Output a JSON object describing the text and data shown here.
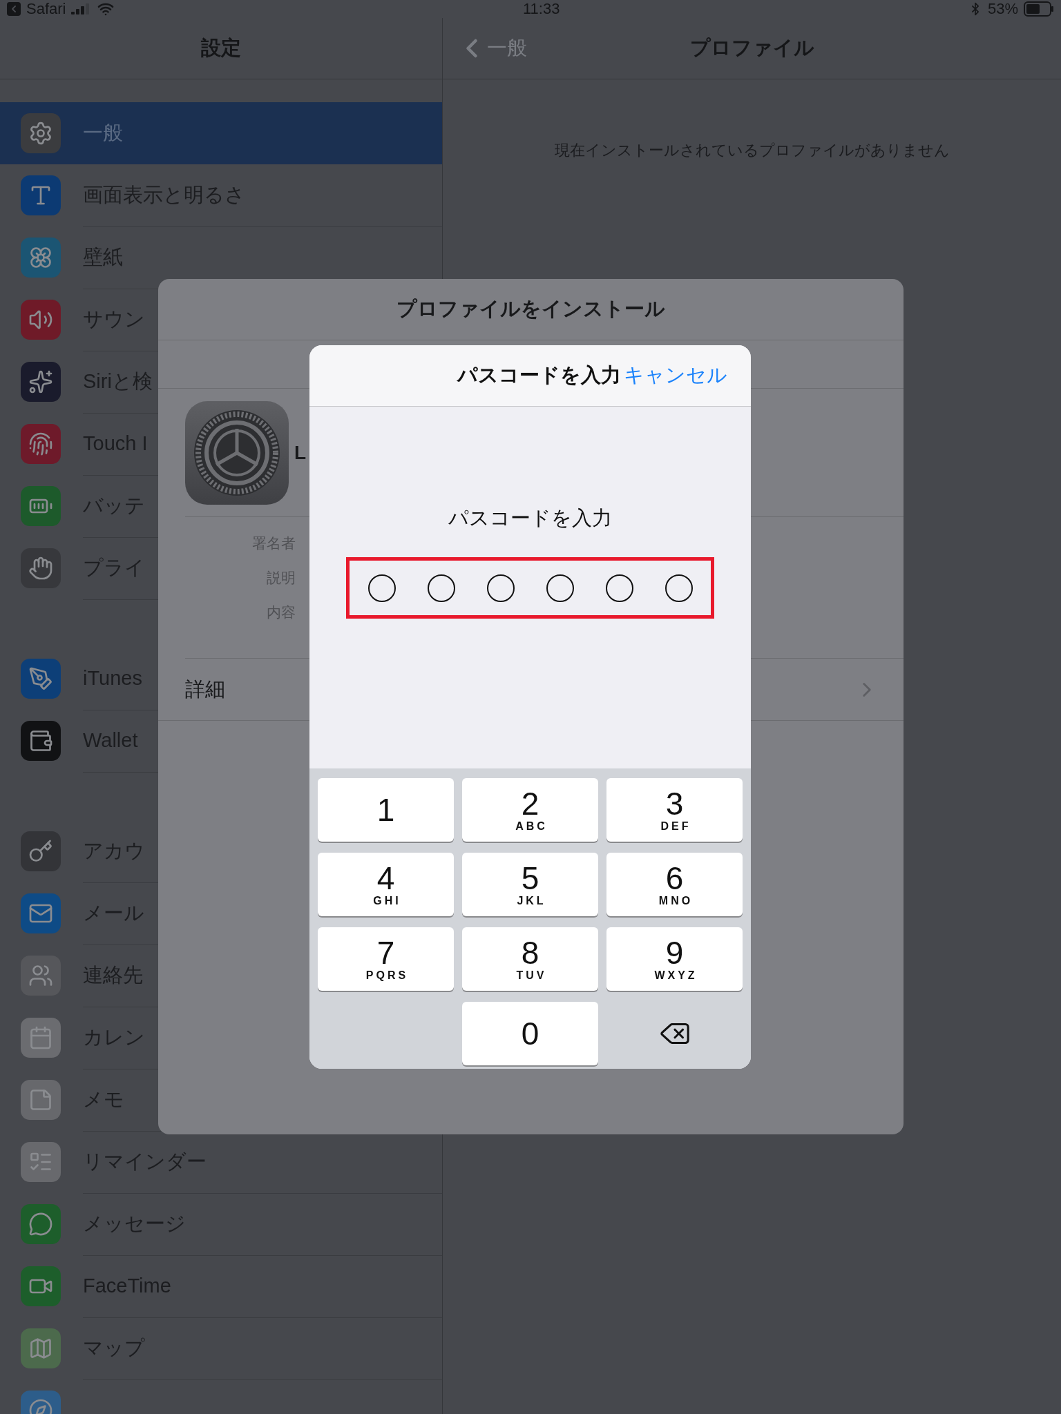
{
  "status_bar": {
    "back_app": "Safari",
    "time": "11:33",
    "battery": "53%"
  },
  "sidebar": {
    "title": "設定",
    "groups": [
      {
        "items": [
          {
            "label": "一般",
            "selected": true
          },
          {
            "label": "画面表示と明るさ",
            "selected": false
          },
          {
            "label": "壁紙",
            "selected": false
          },
          {
            "label": "サウン",
            "selected": false
          },
          {
            "label": "Siriと検",
            "selected": false
          },
          {
            "label": "Touch I",
            "selected": false
          },
          {
            "label": "バッテ",
            "selected": false
          },
          {
            "label": "プライ",
            "selected": false
          }
        ]
      },
      {
        "items": [
          {
            "label": "iTunes",
            "selected": false
          },
          {
            "label": "Wallet",
            "selected": false
          }
        ]
      },
      {
        "items": [
          {
            "label": "アカウ",
            "selected": false
          },
          {
            "label": "メール",
            "selected": false
          },
          {
            "label": "連絡先",
            "selected": false
          },
          {
            "label": "カレン",
            "selected": false
          },
          {
            "label": "メモ",
            "selected": false
          },
          {
            "label": "リマインダー",
            "selected": false
          },
          {
            "label": "メッセージ",
            "selected": false
          },
          {
            "label": "FaceTime",
            "selected": false
          },
          {
            "label": "マップ",
            "selected": false
          },
          {
            "selected": false
          }
        ]
      }
    ]
  },
  "detail": {
    "back": "一般",
    "title": "プロファイル",
    "empty_message": "現在インストールされているプロファイルがありません"
  },
  "install_sheet": {
    "title": "プロファイルをインストール",
    "profile_name": "L",
    "fields": [
      "署名者",
      "説明",
      "内容"
    ],
    "more": "詳細"
  },
  "passcode_dialog": {
    "title": "パスコードを入力",
    "cancel": "キャンセル",
    "prompt": "パスコードを入力",
    "dots": [
      {
        "filled": false
      },
      {
        "filled": false
      },
      {
        "filled": false
      },
      {
        "filled": false
      },
      {
        "filled": false
      },
      {
        "filled": false
      }
    ],
    "keys": [
      {
        "kind": "digit",
        "digit": "1"
      },
      {
        "kind": "digit",
        "digit": "2",
        "letters": "ABC"
      },
      {
        "kind": "digit",
        "digit": "3",
        "letters": "DEF"
      },
      {
        "kind": "digit",
        "digit": "4",
        "letters": "GHI"
      },
      {
        "kind": "digit",
        "digit": "5",
        "letters": "JKL"
      },
      {
        "kind": "digit",
        "digit": "6",
        "letters": "MNO"
      },
      {
        "kind": "digit",
        "digit": "7",
        "letters": "PQRS"
      },
      {
        "kind": "digit",
        "digit": "8",
        "letters": "TUV"
      },
      {
        "kind": "digit",
        "digit": "9",
        "letters": "WXYZ"
      },
      {
        "kind": "blank"
      },
      {
        "kind": "digit",
        "digit": "0"
      },
      {
        "kind": "delete"
      }
    ]
  }
}
